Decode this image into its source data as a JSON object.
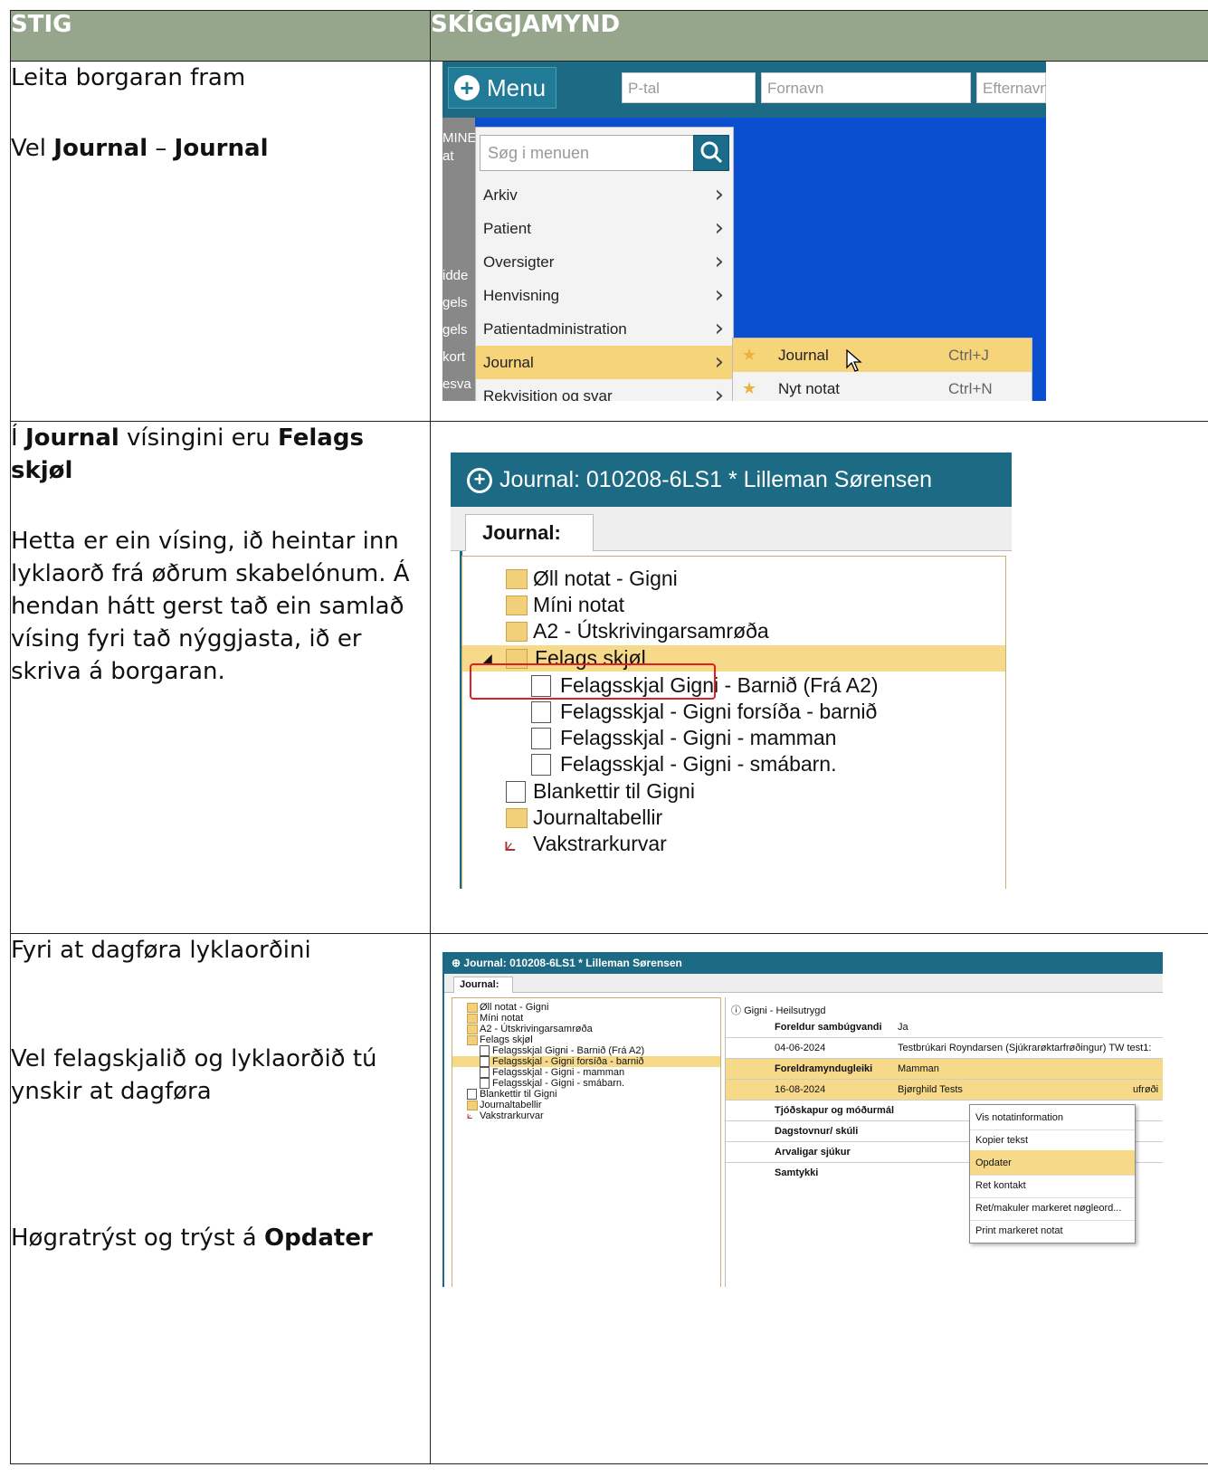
{
  "header": {
    "col1": "STIG",
    "col2": "SKÍGGJAMYND"
  },
  "rows": [
    {
      "lines": [
        {
          "pre": "Leita borgaran fram"
        },
        {
          "pre": "Vel ",
          "b1": "Journal",
          "mid": " – ",
          "b2": "Journal"
        }
      ]
    },
    {
      "lines": [
        {
          "pre": "Í ",
          "b1": "Journal",
          "mid": " vísingini eru ",
          "b2": "Felags skjøl"
        },
        {
          "pre": "Hetta er ein vísing, ið heintar inn lyklaorð frá øðrum skabelónum. Á hendan hátt gerst tað ein samlað vísing fyri tað nýggjasta, ið er skriva á borgaran."
        }
      ]
    },
    {
      "lines": [
        {
          "pre": "Fyri at dagføra lyklaorðini"
        },
        {
          "pre": "Vel felagskjalið og lyklaorðið tú ynskir at dagføra"
        },
        {
          "pre": "Høgratrýst og trýst á ",
          "b1": "Opdater"
        }
      ]
    }
  ],
  "shot1": {
    "menu_label": "Menu",
    "fields": [
      "P-tal",
      "Fornavn",
      "Efternavn"
    ],
    "left_strip": [
      "MINE",
      "at",
      "idde",
      "gels",
      "gels",
      "kort",
      "esva"
    ],
    "search_placeholder": "Søg i menuen",
    "items": [
      "Arkiv",
      "Patient",
      "Oversigter",
      "Henvisning",
      "Patientadministration",
      "Journal",
      "Rekvisition og svar"
    ],
    "sub_items": [
      {
        "label": "Journal",
        "shortcut": "Ctrl+J"
      },
      {
        "label": "Nyt notat",
        "shortcut": "Ctrl+N"
      }
    ]
  },
  "shot2": {
    "title": "Journal: 010208-6LS1 * Lilleman Sørensen",
    "tab": "Journal:",
    "tree": [
      "Øll notat - Gigni",
      "Míni notat",
      "A2 - Útskrivingarsamrøða",
      "Felags skjøl",
      "Felagsskjal Gigni - Barnið (Frá A2)",
      "Felagsskjal - Gigni forsíða - barnið",
      "Felagsskjal - Gigni - mamman",
      "Felagsskjal - Gigni - smábarn.",
      "Blankettir til Gigni",
      "Journaltabellir",
      "Vakstrarkurvar"
    ]
  },
  "shot3": {
    "title": "Journal: 010208-6LS1 * Lilleman Sørensen",
    "tab": "Journal:",
    "detail_head": "Gigni - Heilsutrygd",
    "detail_rows": [
      {
        "c1": "Foreldur sambúgvandi",
        "c2": "Ja"
      },
      {
        "c1": "04-06-2024",
        "c2": "Testbrúkari Royndarsen (Sjúkrarøktarfrøðingur) TW test1:"
      },
      {
        "c1": "Foreldramyndugleiki",
        "c2": "Mamman"
      },
      {
        "c1": "16-08-2024",
        "c2": "Bjørghild Tests"
      },
      {
        "c1": "Tjóðskapur og móðurmál",
        "c2": ""
      },
      {
        "c1": "Dagstovnur/ skúli",
        "c2": ""
      },
      {
        "c1": "Arvaligar sjúkur",
        "c2": ""
      },
      {
        "c1": "Samtykki",
        "c2": ""
      }
    ],
    "row3_tail": "ufrøði",
    "context_menu": [
      "Vis notatinformation",
      "Kopier tekst",
      "Opdater",
      "Ret kontakt",
      "Ret/makuler markeret nøgleord...",
      "Print markeret notat"
    ]
  }
}
